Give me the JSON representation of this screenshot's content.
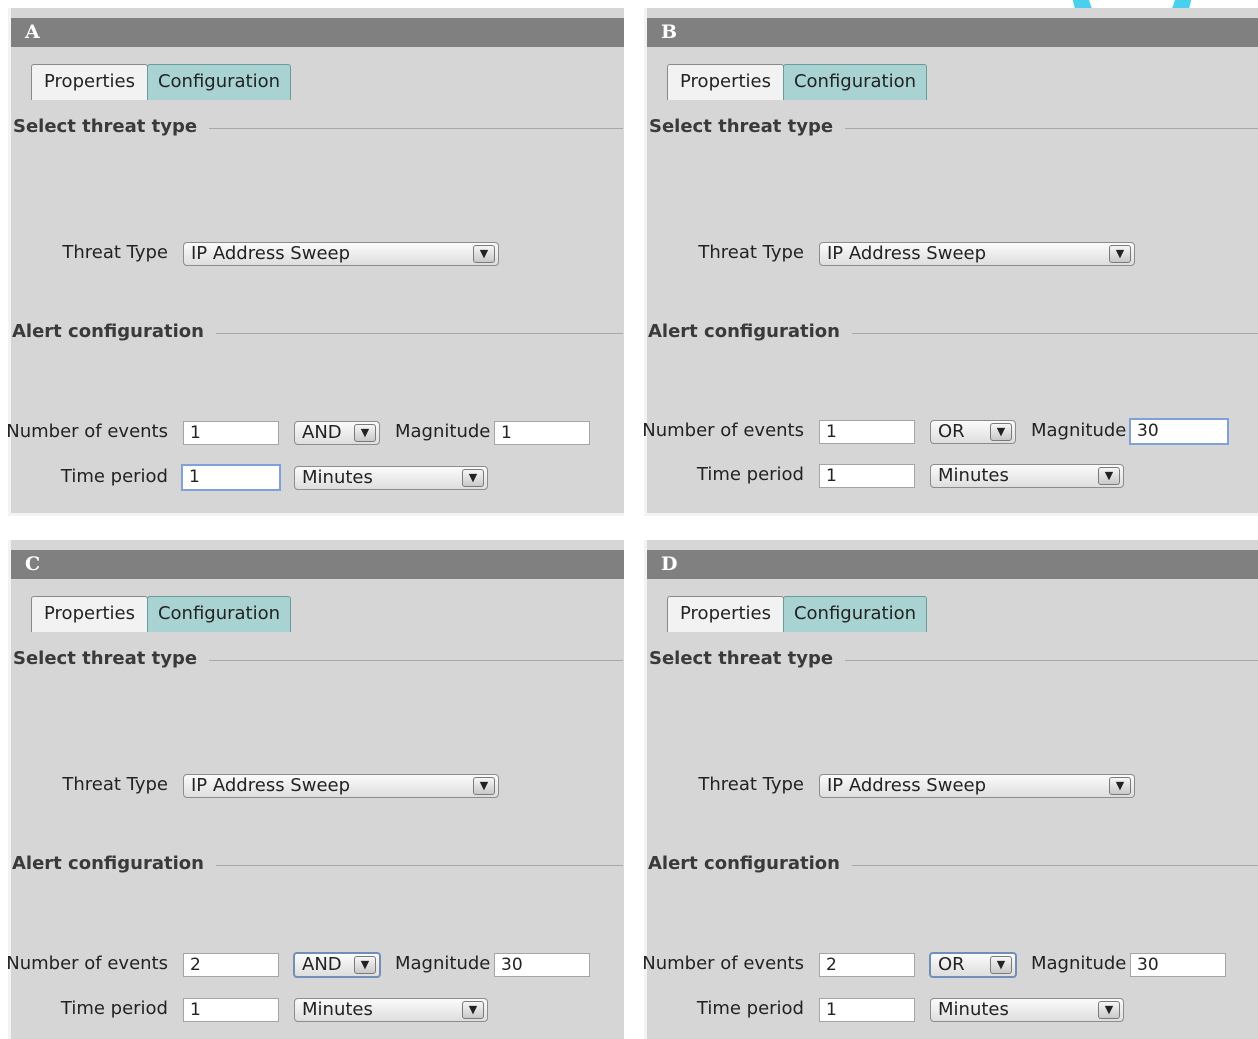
{
  "panels": [
    {
      "id": "A",
      "tabs": [
        "Properties",
        "Configuration"
      ],
      "select_threat_heading": "Select threat type",
      "threat_type_label": "Threat Type",
      "threat_type_value": "IP Address Sweep",
      "alert_heading": "Alert configuration",
      "number_of_events_label": "Number of events",
      "number_of_events_value": "1",
      "logic_value": "AND",
      "magnitude_label": "Magnitude",
      "magnitude_value": "1",
      "time_period_label": "Time period",
      "time_period_value": "1",
      "time_unit_value": "Minutes"
    },
    {
      "id": "B",
      "tabs": [
        "Properties",
        "Configuration"
      ],
      "select_threat_heading": "Select threat type",
      "threat_type_label": "Threat Type",
      "threat_type_value": "IP Address Sweep",
      "alert_heading": "Alert configuration",
      "number_of_events_label": "Number of events",
      "number_of_events_value": "1",
      "logic_value": "OR",
      "magnitude_label": "Magnitude",
      "magnitude_value": "30",
      "time_period_label": "Time period",
      "time_period_value": "1",
      "time_unit_value": "Minutes"
    },
    {
      "id": "C",
      "tabs": [
        "Properties",
        "Configuration"
      ],
      "select_threat_heading": "Select threat type",
      "threat_type_label": "Threat Type",
      "threat_type_value": "IP Address Sweep",
      "alert_heading": "Alert configuration",
      "number_of_events_label": "Number of events",
      "number_of_events_value": "2",
      "logic_value": "AND",
      "magnitude_label": "Magnitude",
      "magnitude_value": "30",
      "time_period_label": "Time period",
      "time_period_value": "1",
      "time_unit_value": "Minutes"
    },
    {
      "id": "D",
      "tabs": [
        "Properties",
        "Configuration"
      ],
      "select_threat_heading": "Select threat type",
      "threat_type_label": "Threat Type",
      "threat_type_value": "IP Address Sweep",
      "alert_heading": "Alert configuration",
      "number_of_events_label": "Number of events",
      "number_of_events_value": "2",
      "logic_value": "OR",
      "magnitude_label": "Magnitude",
      "magnitude_value": "30",
      "time_period_label": "Time period",
      "time_period_value": "1",
      "time_unit_value": "Minutes"
    }
  ],
  "colors": {
    "panel_bg": "#d6d6d6",
    "title_bar": "#808080",
    "active_tab": "#a9d3d3",
    "focus_border": "#7ea2d8",
    "decoration": "#49d0ec"
  },
  "icons": {
    "dropdown": "chevron-down-icon",
    "dropdown_glyph": "▼"
  }
}
